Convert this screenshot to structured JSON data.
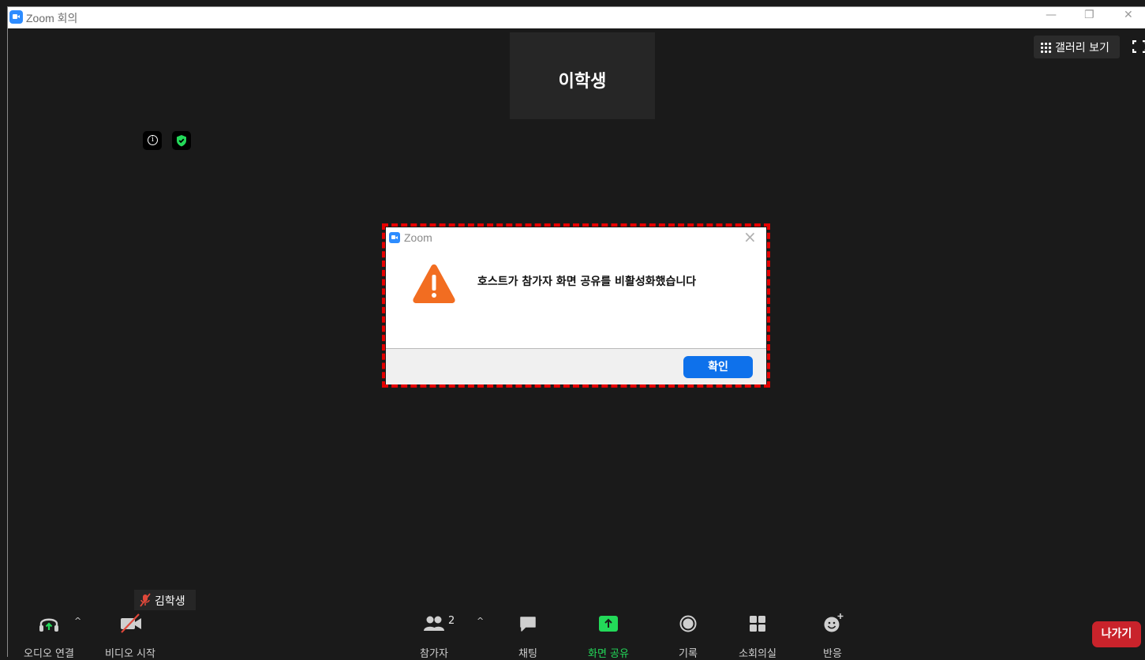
{
  "window": {
    "title": "Zoom 회의"
  },
  "meeting": {
    "speaker_name": "이학생",
    "gallery_label": "갤러리 보기",
    "self_name": "김학생"
  },
  "dialog": {
    "title": "Zoom",
    "message": "호스트가 참가자 화면 공유를 비활성화했습니다",
    "ok_label": "확인"
  },
  "toolbar": {
    "audio_label": "오디오 연결",
    "video_label": "비디오 시작",
    "participants_label": "참가자",
    "participants_count": "2",
    "chat_label": "채팅",
    "share_label": "화면 공유",
    "record_label": "기록",
    "breakout_label": "소회의실",
    "reactions_label": "반응",
    "leave_label": "나가기"
  },
  "colors": {
    "accent_blue": "#0e71eb",
    "share_green": "#23d959",
    "leave_red": "#c9232b",
    "warning_orange": "#f26d21",
    "highlight_red": "#e60000"
  }
}
